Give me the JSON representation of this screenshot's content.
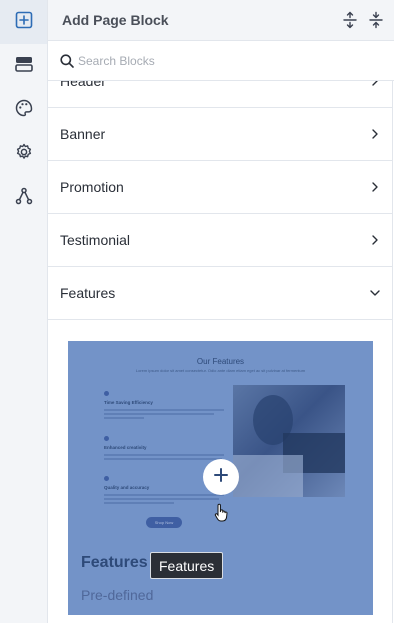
{
  "rail": {
    "items": [
      {
        "icon": "add-block-icon",
        "active": true
      },
      {
        "icon": "layers-icon",
        "active": false
      },
      {
        "icon": "palette-icon",
        "active": false
      },
      {
        "icon": "gear-icon",
        "active": false
      },
      {
        "icon": "workflow-icon",
        "active": false
      }
    ]
  },
  "panel": {
    "title": "Add Page Block",
    "expand_icon": "expand-all-icon",
    "collapse_icon": "collapse-all-icon"
  },
  "search": {
    "placeholder": "Search Blocks",
    "value": ""
  },
  "categories": [
    {
      "label": "Header",
      "expanded": false
    },
    {
      "label": "Banner",
      "expanded": false
    },
    {
      "label": "Promotion",
      "expanded": false
    },
    {
      "label": "Testimonial",
      "expanded": false
    },
    {
      "label": "Features",
      "expanded": true
    }
  ],
  "preview": {
    "name": "Features",
    "type": "Pre-defined",
    "thumb_title": "Our Features",
    "thumb_subtitle": "Lorem ipsum dolor sit amet consectetur. Odio ante diam etiam eget ac sit pulvinar at fermentum",
    "features": [
      "Time Saving Efficiency",
      "Enhanced creativity",
      "Quality and accuracy"
    ],
    "thumb_button": "Shop Now",
    "tooltip": "Features"
  },
  "colors": {
    "accent": "#2e4a79",
    "card_bg": "#7393c8",
    "rail_active": "#e6ebf2"
  }
}
